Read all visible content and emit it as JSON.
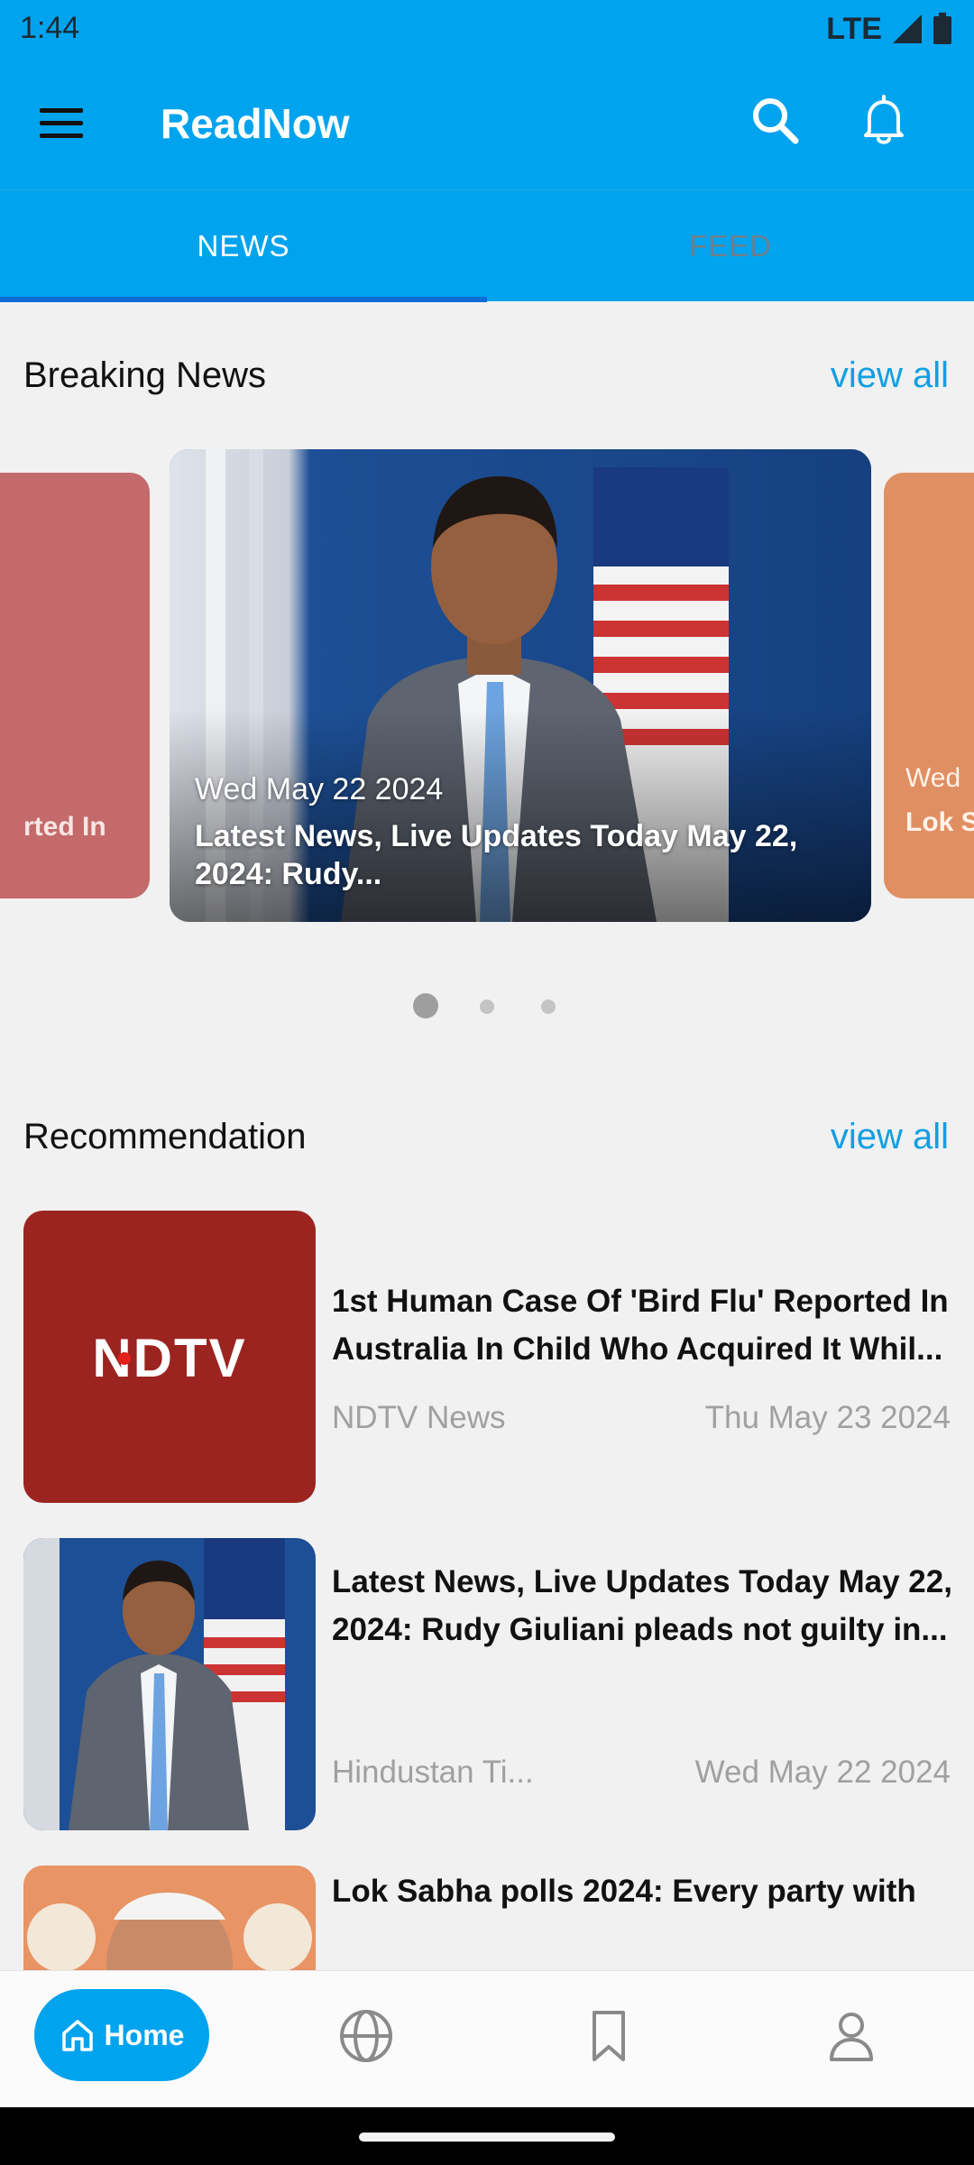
{
  "status": {
    "time": "1:44",
    "network": "LTE"
  },
  "appbar": {
    "title": "ReadNow",
    "menu_icon": "menu-icon",
    "search_icon": "search-icon",
    "notification_icon": "bell-icon"
  },
  "tabs": [
    {
      "label": "NEWS",
      "selected": true
    },
    {
      "label": "FEED",
      "selected": false
    }
  ],
  "breaking": {
    "title": "Breaking News",
    "view_all": "view all",
    "carousel": {
      "left_card": {
        "partial_text": "rted In"
      },
      "main_card": {
        "date": "Wed May 22 2024",
        "headline": "Latest News, Live Updates Today May 22, 2024: Rudy..."
      },
      "right_card": {
        "date": "Wed",
        "headline": "Lok S guilty"
      }
    },
    "page_dots": {
      "count": 3,
      "active": 1
    }
  },
  "recommendation": {
    "title": "Recommendation",
    "view_all": "view all",
    "items": [
      {
        "thumb_text": "NDTV",
        "headline": "1st Human Case Of 'Bird Flu' Reported In Australia In Child Who Acquired It Whil...",
        "source": "NDTV News",
        "date": "Thu May 23 2024"
      },
      {
        "headline": "Latest News, Live Updates Today May 22, 2024: Rudy Giuliani pleads not guilty in...",
        "source": "Hindustan Ti...",
        "date": "Wed May 22 2024"
      },
      {
        "headline": "Lok Sabha polls 2024: Every party with"
      }
    ]
  },
  "bottom_nav": {
    "home_label": "Home",
    "items": [
      "home-icon",
      "globe-icon",
      "bookmark-icon",
      "profile-icon"
    ]
  },
  "colors": {
    "primary": "#00a3ee",
    "tab_indicator": "#0a6bd6",
    "link": "#119fe2",
    "muted_text": "#a0a0a0",
    "background": "#f1f1f1"
  }
}
